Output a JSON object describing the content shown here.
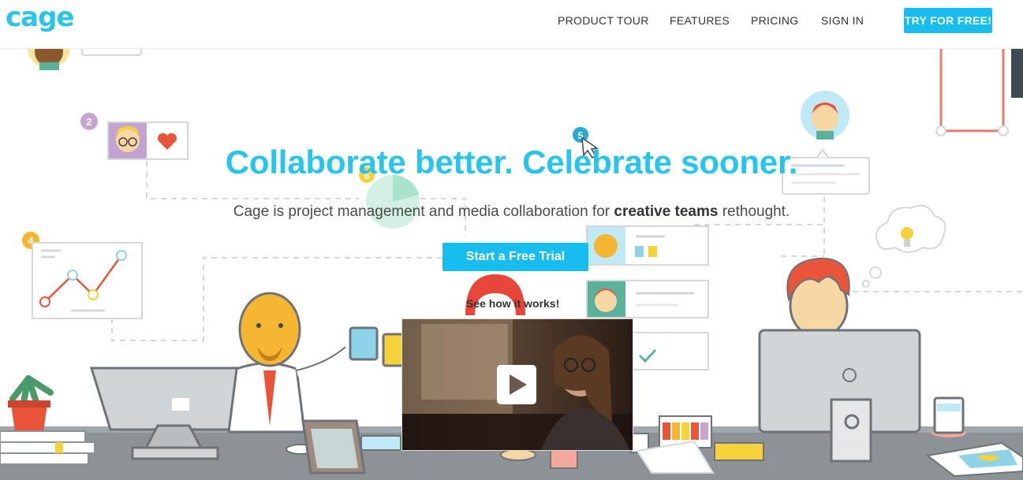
{
  "brand": {
    "name": "cage",
    "color": "#27c4ec"
  },
  "nav": {
    "items": [
      "PRODUCT TOUR",
      "FEATURES",
      "PRICING",
      "SIGN IN"
    ],
    "cta": "TRY FOR FREE!"
  },
  "hero": {
    "title": "Collaborate better. Celebrate sooner.",
    "subtitle_before": "Cage is project management and media collaboration for ",
    "subtitle_bold": "creative teams",
    "subtitle_after": " rethought.",
    "cta": "Start a Free Trial",
    "video_label": "See how it works!"
  },
  "illustration": {
    "step_badges": [
      "2",
      "4",
      "5",
      "6"
    ]
  },
  "colors": {
    "accent": "#16bdee",
    "title": "#27c4ec",
    "skin": "#f5b731",
    "hair": "#e8553a"
  }
}
